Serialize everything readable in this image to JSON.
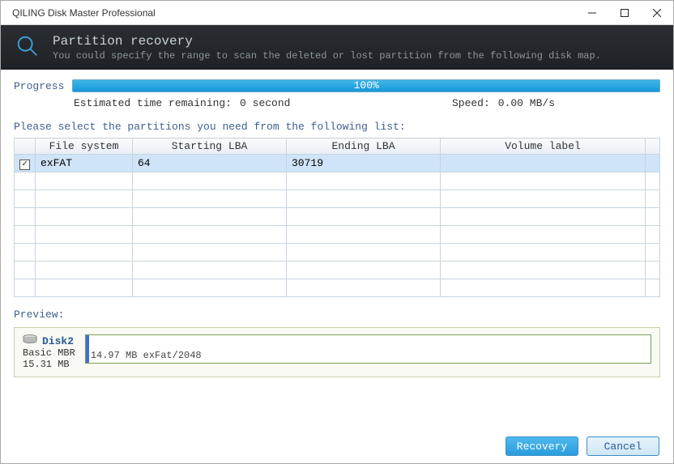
{
  "window": {
    "title": "QILING Disk Master Professional"
  },
  "banner": {
    "title": "Partition recovery",
    "subtitle": "You could specify the range to scan the deleted or lost partition from the following disk map."
  },
  "progress": {
    "label": "Progress",
    "percent_text": "100%",
    "time_label": "Estimated time remaining:",
    "time_value": "0 second",
    "speed_label": "Speed:",
    "speed_value": "0.00 MB/s"
  },
  "table": {
    "instruction": "Please select the partitions you need from the following list:",
    "headers": {
      "fs": "File system",
      "start": "Starting LBA",
      "end": "Ending LBA",
      "label": "Volume label"
    },
    "rows": [
      {
        "checked": true,
        "fs": "exFAT",
        "start": "64",
        "end": "30719",
        "label": ""
      }
    ]
  },
  "preview": {
    "label": "Preview:",
    "disk_name": "Disk2",
    "disk_type": "Basic MBR",
    "disk_size": "15.31 MB",
    "partition_text": "14.97 MB exFat/2048"
  },
  "buttons": {
    "recovery": "Recovery",
    "cancel": "Cancel"
  }
}
